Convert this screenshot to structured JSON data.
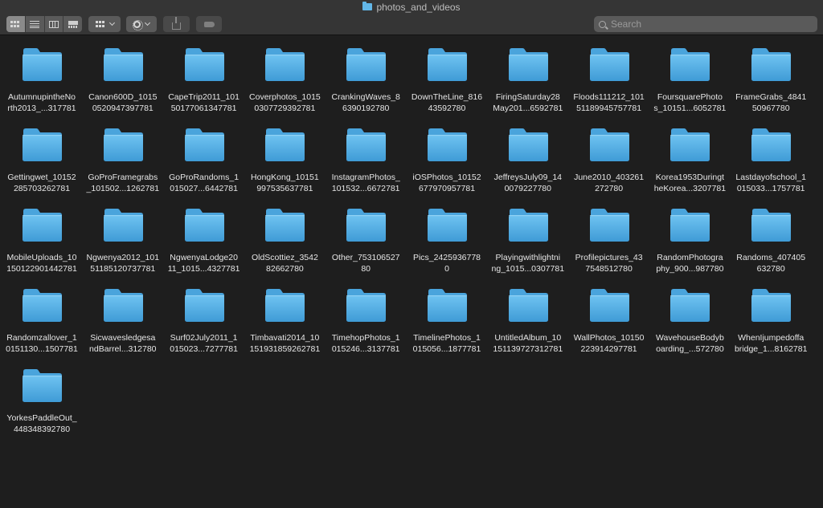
{
  "window": {
    "title": "photos_and_videos"
  },
  "toolbar": {
    "view_modes": [
      {
        "name": "view-icons-button",
        "icon": "grid-icon",
        "active": true
      },
      {
        "name": "view-list-button",
        "icon": "list-icon",
        "active": false
      },
      {
        "name": "view-columns-button",
        "icon": "columns-icon",
        "active": false
      },
      {
        "name": "view-gallery-button",
        "icon": "gallery-icon",
        "active": false
      }
    ],
    "group_icon": "grid-icon",
    "action_icon": "gear-icon",
    "share_icon": "share-icon",
    "tag_icon": "tag-icon"
  },
  "search": {
    "placeholder": "Search",
    "value": ""
  },
  "colors": {
    "folder_top": "#6fc3f1",
    "folder_bottom": "#3f9bd6",
    "folder_tab": "#4aa4dc",
    "text": "#e6e6e6",
    "background": "#1e1e1e"
  },
  "folders": [
    {
      "line1": "AutumnupintheNo",
      "line2": "rth2013_...317781"
    },
    {
      "line1": "Canon600D_1015",
      "line2": "0520947397781"
    },
    {
      "line1": "CapeTrip2011_101",
      "line2": "50177061347781"
    },
    {
      "line1": "Coverphotos_1015",
      "line2": "0307729392781"
    },
    {
      "line1": "CrankingWaves_8",
      "line2": "6390192780"
    },
    {
      "line1": "DownTheLine_816",
      "line2": "43592780"
    },
    {
      "line1": "FiringSaturday28",
      "line2": "May201...6592781"
    },
    {
      "line1": "Floods111212_101",
      "line2": "51189945757781"
    },
    {
      "line1": "FoursquarePhoto",
      "line2": "s_10151...6052781"
    },
    {
      "line1": "FrameGrabs_4841",
      "line2": "50967780"
    },
    {
      "line1": "Gettingwet_10152",
      "line2": "285703262781"
    },
    {
      "line1": "GoProFramegrabs",
      "line2": "_101502...1262781"
    },
    {
      "line1": "GoProRandoms_1",
      "line2": "015027...6442781"
    },
    {
      "line1": "HongKong_10151",
      "line2": "997535637781"
    },
    {
      "line1": "InstagramPhotos_",
      "line2": "101532...6672781"
    },
    {
      "line1": "iOSPhotos_10152",
      "line2": "677970957781"
    },
    {
      "line1": "JeffreysJuly09_14",
      "line2": "0079227780"
    },
    {
      "line1": "June2010_403261",
      "line2": "272780"
    },
    {
      "line1": "Korea1953Duringt",
      "line2": "heKorea...3207781"
    },
    {
      "line1": "Lastdayofschool_1",
      "line2": "015033...1757781"
    },
    {
      "line1": "MobileUploads_10",
      "line2": "150122901442781"
    },
    {
      "line1": "Ngwenya2012_101",
      "line2": "51185120737781"
    },
    {
      "line1": "NgwenyaLodge20",
      "line2": "11_1015...4327781"
    },
    {
      "line1": "OldScottiez_3542",
      "line2": "82662780"
    },
    {
      "line1": "Other_753106527",
      "line2": "80"
    },
    {
      "line1": "Pics_2425936778",
      "line2": "0"
    },
    {
      "line1": "Playingwithlightni",
      "line2": "ng_1015...0307781"
    },
    {
      "line1": "Profilepictures_43",
      "line2": "7548512780"
    },
    {
      "line1": "RandomPhotogra",
      "line2": "phy_900...987780"
    },
    {
      "line1": "Randoms_407405",
      "line2": "632780"
    },
    {
      "line1": "Randomzallover_1",
      "line2": "0151130...1507781"
    },
    {
      "line1": "Sicwavesledgesa",
      "line2": "ndBarrel...312780"
    },
    {
      "line1": "Surf02July2011_1",
      "line2": "015023...7277781"
    },
    {
      "line1": "Timbavati2014_10",
      "line2": "151931859262781"
    },
    {
      "line1": "TimehopPhotos_1",
      "line2": "015246...3137781"
    },
    {
      "line1": "TimelinePhotos_1",
      "line2": "015056...1877781"
    },
    {
      "line1": "UntitledAlbum_10",
      "line2": "151139727312781"
    },
    {
      "line1": "WallPhotos_10150",
      "line2": "223914297781"
    },
    {
      "line1": "WavehouseBodyb",
      "line2": "oarding_...572780"
    },
    {
      "line1": "WhenIjumpedoffa",
      "line2": "bridge_1...8162781"
    },
    {
      "line1": "YorkesPaddleOut_",
      "line2": "448348392780"
    }
  ]
}
